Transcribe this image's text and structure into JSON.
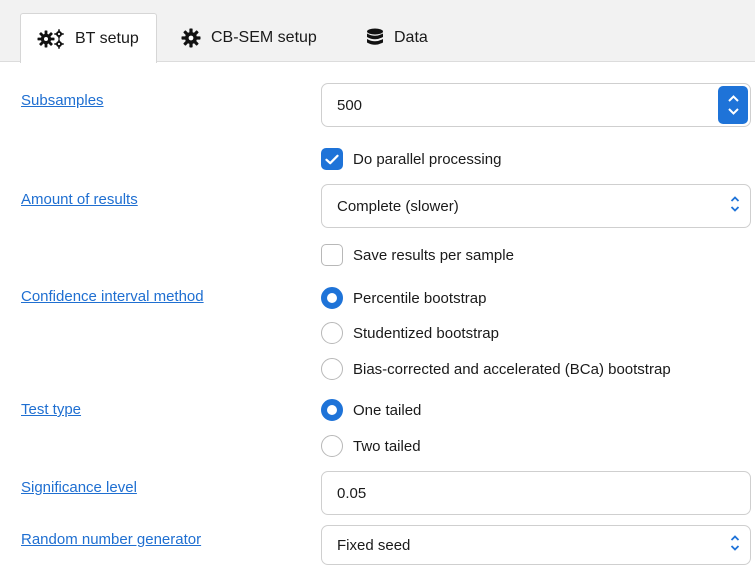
{
  "tabs": [
    {
      "label": "BT setup",
      "icon": "gears-icon",
      "active": true
    },
    {
      "label": "CB-SEM setup",
      "icon": "gear-icon",
      "active": false
    },
    {
      "label": "Data",
      "icon": "database-icon",
      "active": false
    }
  ],
  "subsamples": {
    "label": "Subsamples",
    "value": "500"
  },
  "parallel": {
    "label": "Do parallel processing",
    "checked": true
  },
  "amount_of_results": {
    "label": "Amount of results",
    "value": "Complete (slower)"
  },
  "save_per_sample": {
    "label": "Save results per sample",
    "checked": false
  },
  "ci_method": {
    "label": "Confidence interval method",
    "options": [
      "Percentile bootstrap",
      "Studentized bootstrap",
      "Bias-corrected and accelerated (BCa) bootstrap"
    ],
    "selected": "Percentile bootstrap"
  },
  "test_type": {
    "label": "Test type",
    "options": [
      "One tailed",
      "Two tailed"
    ],
    "selected": "One tailed"
  },
  "significance": {
    "label": "Significance level",
    "value": "0.05"
  },
  "rng": {
    "label": "Random number generator",
    "value": "Fixed seed"
  },
  "colors": {
    "accent": "#1e73d8",
    "link": "#1f6fd1"
  }
}
